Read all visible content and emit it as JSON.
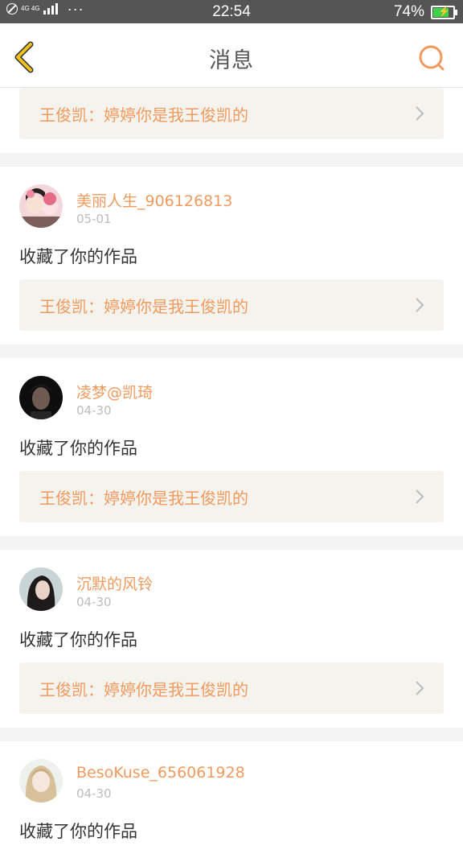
{
  "status_bar": {
    "network_label": "4G 4G",
    "dots": "···",
    "time": "22:54",
    "battery": "74%"
  },
  "navbar": {
    "title": "消息",
    "back_icon": "chevron-left-icon",
    "search_icon": "search-icon"
  },
  "colors": {
    "accent": "#f09a5e",
    "back_icon": "#f2c21c",
    "statusbar_bg": "#555555",
    "box_bg": "#f4f3ee"
  },
  "top_partial": {
    "work_title": "王俊凯：婷婷你是我王俊凯的"
  },
  "items": [
    {
      "username": "美丽人生_906126813",
      "date": "05-01",
      "action": "收藏了你的作品",
      "work_title": "王俊凯：婷婷你是我王俊凯的"
    },
    {
      "username": "凌梦@凯琦",
      "date": "04-30",
      "action": "收藏了你的作品",
      "work_title": "王俊凯：婷婷你是我王俊凯的"
    },
    {
      "username": "沉默的风铃",
      "date": "04-30",
      "action": "收藏了你的作品",
      "work_title": "王俊凯：婷婷你是我王俊凯的"
    },
    {
      "username": "BesoKuse_656061928",
      "date": "04-30",
      "action": "收藏了你的作品"
    }
  ]
}
